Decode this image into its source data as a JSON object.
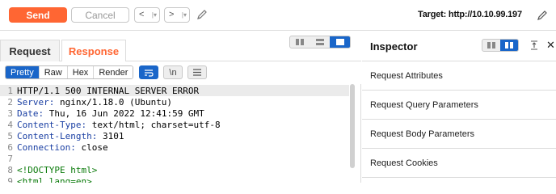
{
  "toolbar": {
    "send_label": "Send",
    "cancel_label": "Cancel",
    "back_glyph": "<",
    "forward_glyph": ">",
    "target_label": "Target: http://10.10.99.197",
    "accent_color": "#ff6633"
  },
  "tabs": {
    "request": "Request",
    "response": "Response",
    "active": "Response"
  },
  "format": {
    "buttons": [
      "Pretty",
      "Raw",
      "Hex",
      "Render"
    ],
    "active": "Pretty",
    "newline_label": "\\n"
  },
  "response_lines": [
    {
      "num": "1",
      "key": "",
      "value": "HTTP/1.1 500 INTERNAL SERVER ERROR"
    },
    {
      "num": "2",
      "key": "Server:",
      "value": " nginx/1.18.0 (Ubuntu)"
    },
    {
      "num": "3",
      "key": "Date:",
      "value": " Thu, 16 Jun 2022 12:41:59 GMT"
    },
    {
      "num": "4",
      "key": "Content-Type:",
      "value": " text/html; charset=utf-8"
    },
    {
      "num": "5",
      "key": "Content-Length:",
      "value": " 3101"
    },
    {
      "num": "6",
      "key": "Connection:",
      "value": " close"
    },
    {
      "num": "7",
      "key": "",
      "value": ""
    },
    {
      "num": "8",
      "key": "",
      "value": "<!DOCTYPE html>"
    },
    {
      "num": "9",
      "key": "",
      "value": "<html lang=en>"
    }
  ],
  "inspector": {
    "title": "Inspector",
    "items": [
      "Request Attributes",
      "Request Query Parameters",
      "Request Body Parameters",
      "Request Cookies"
    ]
  },
  "icons": {
    "pencil": "pencil-icon",
    "wrap": "wrap-lines-icon",
    "menu": "hamburger-menu-icon",
    "close": "close-icon",
    "align": "align-center-icon"
  }
}
